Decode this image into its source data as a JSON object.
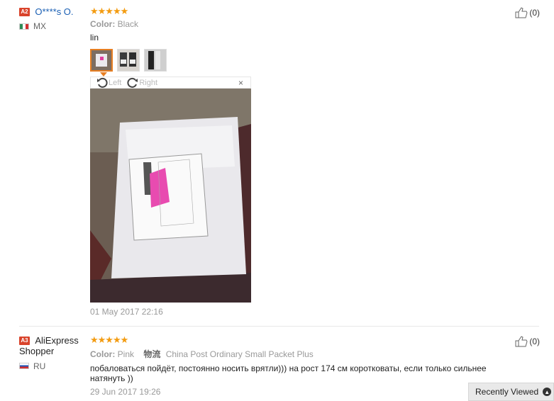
{
  "reviews": [
    {
      "level": "A2",
      "user": "O****s O.",
      "country": "MX",
      "stars": "★★★★★",
      "color_label": "Color:",
      "color_value": "Black",
      "text": "lin",
      "viewer": {
        "left_label": "Left",
        "right_label": "Right",
        "close": "×"
      },
      "date": "01 May 2017 22:16",
      "helpful_count": "(0)"
    },
    {
      "level": "A3",
      "user": "AliExpress Shopper",
      "country": "RU",
      "stars": "★★★★★",
      "color_label": "Color:",
      "color_value": "Pink",
      "shipping_label": "物流",
      "shipping_value": "China Post Ordinary Small Packet Plus",
      "text": "побаловаться пойдёт, постоянно носить врятли))) на рост 174 см коротковаты, если только сильнее натянуть ))",
      "date": "29 Jun 2017 19:26",
      "helpful_count": "(0)"
    }
  ],
  "recently_viewed": "Recently Viewed",
  "colors": {
    "star": "#f39c12",
    "badge": "#d9432b",
    "link": "#1a5fb4",
    "active_thumb": "#e67e22"
  }
}
